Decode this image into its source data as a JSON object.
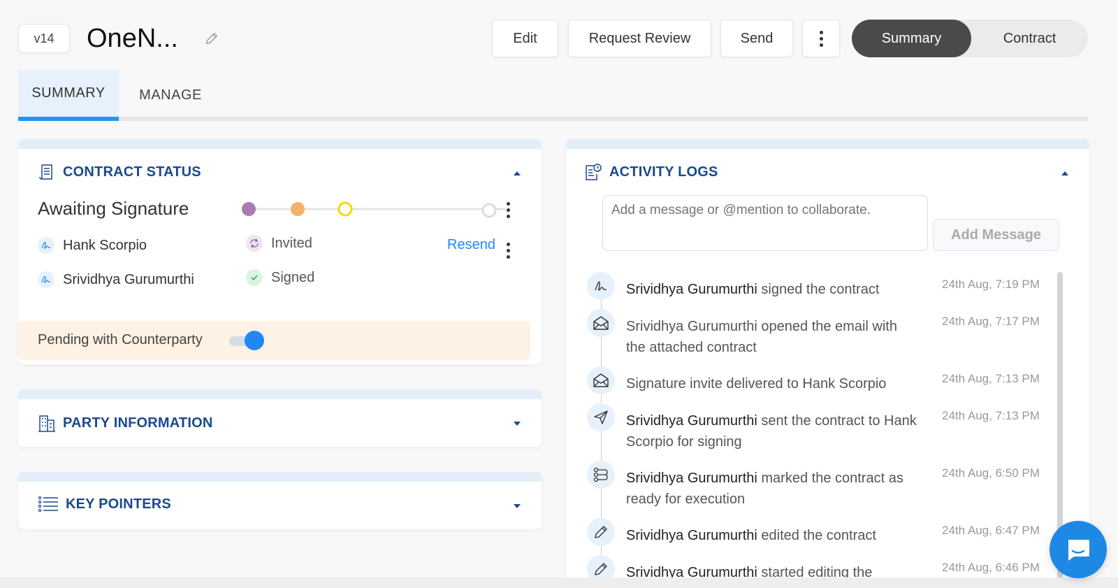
{
  "header": {
    "version": "v14",
    "title": "OneN...",
    "buttons": {
      "edit": "Edit",
      "request_review": "Request Review",
      "send": "Send"
    },
    "view_toggle": {
      "summary": "Summary",
      "contract": "Contract"
    }
  },
  "tabs": {
    "summary": "SUMMARY",
    "manage": "MANAGE"
  },
  "contract_status": {
    "title": "CONTRACT STATUS",
    "status": "Awaiting Signature",
    "progress_step": 3,
    "progress_total": 4,
    "signers": [
      {
        "name": "Hank Scorpio",
        "status": "Invited",
        "action": "Resend"
      },
      {
        "name": "Srividhya Gurumurthi",
        "status": "Signed"
      }
    ],
    "pending_label": "Pending with Counterparty",
    "pending_toggle": true
  },
  "party_information": {
    "title": "PARTY INFORMATION"
  },
  "key_pointers": {
    "title": "KEY POINTERS"
  },
  "activity_logs": {
    "title": "ACTIVITY LOGS",
    "message_placeholder": "Add a message or @mention to collaborate.",
    "add_button": "Add Message",
    "entries": [
      {
        "icon": "signature-icon",
        "actor": "Srividhya Gurumurthi",
        "text": " signed the contract",
        "time": "24th Aug, 7:19 PM"
      },
      {
        "icon": "envelope-open-icon",
        "actor": "",
        "text": "Srividhya Gurumurthi opened the email with the attached contract",
        "time": "24th Aug, 7:17 PM"
      },
      {
        "icon": "envelope-open-icon",
        "actor": "",
        "text": "Signature invite delivered to Hank Scorpio",
        "time": "24th Aug, 7:13 PM"
      },
      {
        "icon": "send-icon",
        "actor": "Srividhya Gurumurthi",
        "text": " sent the contract to Hank Scorpio for signing",
        "time": "24th Aug, 7:13 PM"
      },
      {
        "icon": "workflow-icon",
        "actor": "Srividhya Gurumurthi",
        "text": " marked the contract as ready for execution",
        "time": "24th Aug, 6:50 PM"
      },
      {
        "icon": "pencil-icon",
        "actor": "Srividhya Gurumurthi",
        "text": " edited the contract",
        "time": "24th Aug, 6:47 PM"
      },
      {
        "icon": "pencil-icon",
        "actor": "Srividhya Gurumurthi",
        "text": " started editing the",
        "time": "24th Aug, 6:46 PM"
      }
    ]
  },
  "colors": {
    "accent": "#2188f3",
    "heading": "#1a4a8c",
    "active_toggle": "#4a4a4a",
    "pending_bg": "#fdf2e3"
  }
}
